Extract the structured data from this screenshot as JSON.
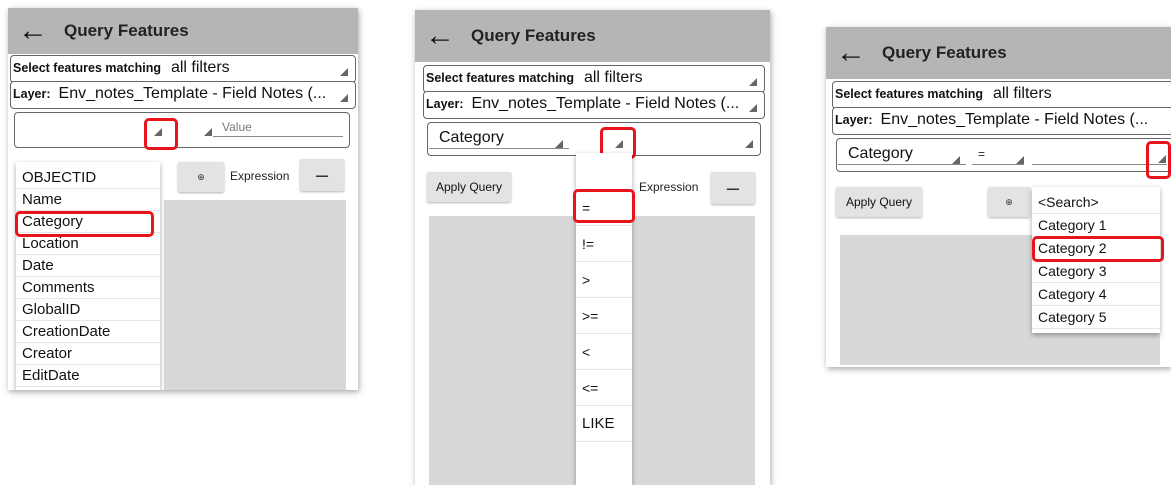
{
  "colors": {
    "highlight": "#e8141b",
    "appbar": "#b5b5b5"
  },
  "panel1": {
    "title": "Query Features",
    "select_label": "Select features matching",
    "select_value": "all filters",
    "layer_label": "Layer:",
    "layer_value": "Env_notes_Template - Field Notes (...",
    "value_placeholder": "Value",
    "expression_label": "Expression",
    "field_options": [
      "OBJECTID",
      "Name",
      "Category",
      "Location",
      "Date",
      "Comments",
      "GlobalID",
      "CreationDate",
      "Creator",
      "EditDate"
    ],
    "selected_field": "Category"
  },
  "panel2": {
    "title": "Query Features",
    "select_label": "Select features matching",
    "select_value": "all filters",
    "layer_label": "Layer:",
    "layer_value": "Env_notes_Template - Field Notes (...",
    "field_value": "Category",
    "apply_label": "Apply Query",
    "expression_label": "Expression",
    "operator_options": [
      "=",
      "!=",
      ">",
      ">=",
      "<",
      "<=",
      "LIKE"
    ],
    "selected_operator": "="
  },
  "panel3": {
    "title": "Query Features",
    "select_label": "Select features matching",
    "select_value": "all filters",
    "layer_label": "Layer:",
    "layer_value": "Env_notes_Template - Field Notes (...",
    "field_value": "Category",
    "operator_value": "=",
    "apply_label": "Apply Query",
    "value_options": [
      "<Search>",
      "Category 1",
      "Category 2",
      "Category 3",
      "Category 4",
      "Category 5"
    ],
    "selected_value": "Category 2"
  }
}
